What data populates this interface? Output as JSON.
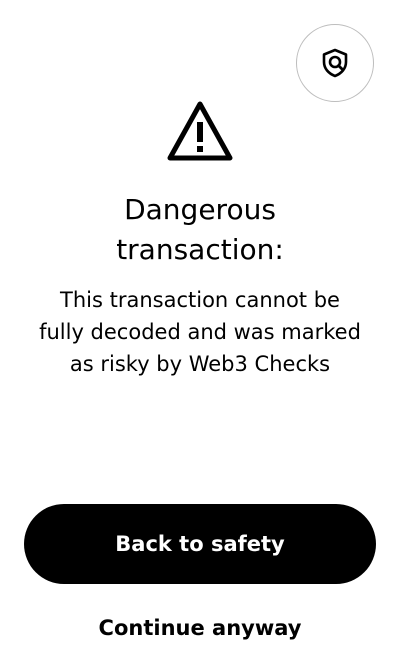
{
  "header": {
    "scan_icon": "shield-search-icon"
  },
  "alert": {
    "icon": "warning-triangle-icon",
    "title_line1": "Dangerous",
    "title_line2": "transaction:",
    "description_line1": "This transaction cannot be",
    "description_line2": "fully decoded and was marked",
    "description_line3": "as risky by Web3 Checks"
  },
  "actions": {
    "primary_label": "Back to safety",
    "secondary_label": "Continue anyway"
  },
  "colors": {
    "background": "#ffffff",
    "primary": "#000000",
    "primary_text": "#ffffff",
    "outline": "#bdbdbd"
  }
}
